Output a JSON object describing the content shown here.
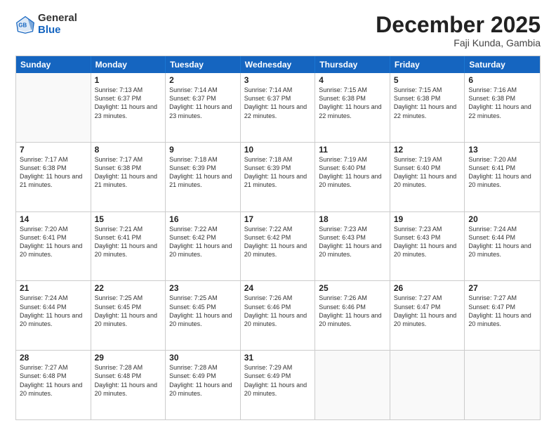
{
  "header": {
    "logo_general": "General",
    "logo_blue": "Blue",
    "month_title": "December 2025",
    "location": "Faji Kunda, Gambia"
  },
  "weekdays": [
    "Sunday",
    "Monday",
    "Tuesday",
    "Wednesday",
    "Thursday",
    "Friday",
    "Saturday"
  ],
  "weeks": [
    [
      {
        "day": "",
        "sunrise": "",
        "sunset": "",
        "daylight": ""
      },
      {
        "day": "1",
        "sunrise": "Sunrise: 7:13 AM",
        "sunset": "Sunset: 6:37 PM",
        "daylight": "Daylight: 11 hours and 23 minutes."
      },
      {
        "day": "2",
        "sunrise": "Sunrise: 7:14 AM",
        "sunset": "Sunset: 6:37 PM",
        "daylight": "Daylight: 11 hours and 23 minutes."
      },
      {
        "day": "3",
        "sunrise": "Sunrise: 7:14 AM",
        "sunset": "Sunset: 6:37 PM",
        "daylight": "Daylight: 11 hours and 22 minutes."
      },
      {
        "day": "4",
        "sunrise": "Sunrise: 7:15 AM",
        "sunset": "Sunset: 6:38 PM",
        "daylight": "Daylight: 11 hours and 22 minutes."
      },
      {
        "day": "5",
        "sunrise": "Sunrise: 7:15 AM",
        "sunset": "Sunset: 6:38 PM",
        "daylight": "Daylight: 11 hours and 22 minutes."
      },
      {
        "day": "6",
        "sunrise": "Sunrise: 7:16 AM",
        "sunset": "Sunset: 6:38 PM",
        "daylight": "Daylight: 11 hours and 22 minutes."
      }
    ],
    [
      {
        "day": "7",
        "sunrise": "Sunrise: 7:17 AM",
        "sunset": "Sunset: 6:38 PM",
        "daylight": "Daylight: 11 hours and 21 minutes."
      },
      {
        "day": "8",
        "sunrise": "Sunrise: 7:17 AM",
        "sunset": "Sunset: 6:38 PM",
        "daylight": "Daylight: 11 hours and 21 minutes."
      },
      {
        "day": "9",
        "sunrise": "Sunrise: 7:18 AM",
        "sunset": "Sunset: 6:39 PM",
        "daylight": "Daylight: 11 hours and 21 minutes."
      },
      {
        "day": "10",
        "sunrise": "Sunrise: 7:18 AM",
        "sunset": "Sunset: 6:39 PM",
        "daylight": "Daylight: 11 hours and 21 minutes."
      },
      {
        "day": "11",
        "sunrise": "Sunrise: 7:19 AM",
        "sunset": "Sunset: 6:40 PM",
        "daylight": "Daylight: 11 hours and 20 minutes."
      },
      {
        "day": "12",
        "sunrise": "Sunrise: 7:19 AM",
        "sunset": "Sunset: 6:40 PM",
        "daylight": "Daylight: 11 hours and 20 minutes."
      },
      {
        "day": "13",
        "sunrise": "Sunrise: 7:20 AM",
        "sunset": "Sunset: 6:41 PM",
        "daylight": "Daylight: 11 hours and 20 minutes."
      }
    ],
    [
      {
        "day": "14",
        "sunrise": "Sunrise: 7:20 AM",
        "sunset": "Sunset: 6:41 PM",
        "daylight": "Daylight: 11 hours and 20 minutes."
      },
      {
        "day": "15",
        "sunrise": "Sunrise: 7:21 AM",
        "sunset": "Sunset: 6:41 PM",
        "daylight": "Daylight: 11 hours and 20 minutes."
      },
      {
        "day": "16",
        "sunrise": "Sunrise: 7:22 AM",
        "sunset": "Sunset: 6:42 PM",
        "daylight": "Daylight: 11 hours and 20 minutes."
      },
      {
        "day": "17",
        "sunrise": "Sunrise: 7:22 AM",
        "sunset": "Sunset: 6:42 PM",
        "daylight": "Daylight: 11 hours and 20 minutes."
      },
      {
        "day": "18",
        "sunrise": "Sunrise: 7:23 AM",
        "sunset": "Sunset: 6:43 PM",
        "daylight": "Daylight: 11 hours and 20 minutes."
      },
      {
        "day": "19",
        "sunrise": "Sunrise: 7:23 AM",
        "sunset": "Sunset: 6:43 PM",
        "daylight": "Daylight: 11 hours and 20 minutes."
      },
      {
        "day": "20",
        "sunrise": "Sunrise: 7:24 AM",
        "sunset": "Sunset: 6:44 PM",
        "daylight": "Daylight: 11 hours and 20 minutes."
      }
    ],
    [
      {
        "day": "21",
        "sunrise": "Sunrise: 7:24 AM",
        "sunset": "Sunset: 6:44 PM",
        "daylight": "Daylight: 11 hours and 20 minutes."
      },
      {
        "day": "22",
        "sunrise": "Sunrise: 7:25 AM",
        "sunset": "Sunset: 6:45 PM",
        "daylight": "Daylight: 11 hours and 20 minutes."
      },
      {
        "day": "23",
        "sunrise": "Sunrise: 7:25 AM",
        "sunset": "Sunset: 6:45 PM",
        "daylight": "Daylight: 11 hours and 20 minutes."
      },
      {
        "day": "24",
        "sunrise": "Sunrise: 7:26 AM",
        "sunset": "Sunset: 6:46 PM",
        "daylight": "Daylight: 11 hours and 20 minutes."
      },
      {
        "day": "25",
        "sunrise": "Sunrise: 7:26 AM",
        "sunset": "Sunset: 6:46 PM",
        "daylight": "Daylight: 11 hours and 20 minutes."
      },
      {
        "day": "26",
        "sunrise": "Sunrise: 7:27 AM",
        "sunset": "Sunset: 6:47 PM",
        "daylight": "Daylight: 11 hours and 20 minutes."
      },
      {
        "day": "27",
        "sunrise": "Sunrise: 7:27 AM",
        "sunset": "Sunset: 6:47 PM",
        "daylight": "Daylight: 11 hours and 20 minutes."
      }
    ],
    [
      {
        "day": "28",
        "sunrise": "Sunrise: 7:27 AM",
        "sunset": "Sunset: 6:48 PM",
        "daylight": "Daylight: 11 hours and 20 minutes."
      },
      {
        "day": "29",
        "sunrise": "Sunrise: 7:28 AM",
        "sunset": "Sunset: 6:48 PM",
        "daylight": "Daylight: 11 hours and 20 minutes."
      },
      {
        "day": "30",
        "sunrise": "Sunrise: 7:28 AM",
        "sunset": "Sunset: 6:49 PM",
        "daylight": "Daylight: 11 hours and 20 minutes."
      },
      {
        "day": "31",
        "sunrise": "Sunrise: 7:29 AM",
        "sunset": "Sunset: 6:49 PM",
        "daylight": "Daylight: 11 hours and 20 minutes."
      },
      {
        "day": "",
        "sunrise": "",
        "sunset": "",
        "daylight": ""
      },
      {
        "day": "",
        "sunrise": "",
        "sunset": "",
        "daylight": ""
      },
      {
        "day": "",
        "sunrise": "",
        "sunset": "",
        "daylight": ""
      }
    ]
  ]
}
